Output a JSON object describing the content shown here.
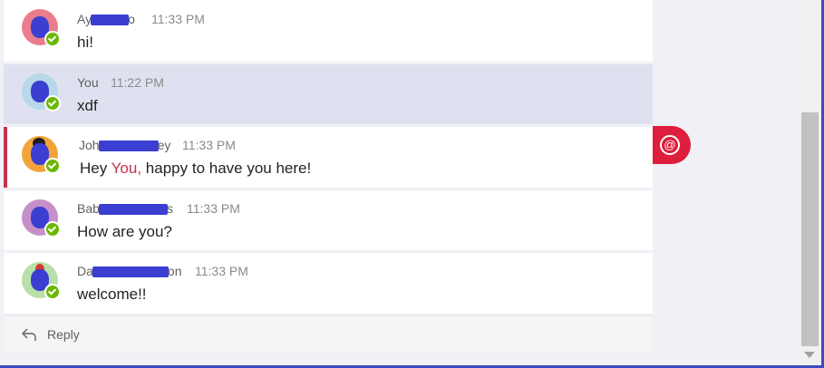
{
  "messages": [
    {
      "sender_visible_start": "Ay",
      "sender_visible_end": "o",
      "time": "11:33 PM",
      "text": "hi!",
      "avatar_bg": "#e97d8e"
    },
    {
      "sender": "You",
      "time": "11:22 PM",
      "text": "xdf",
      "avatar_bg": "#b7d8e8"
    },
    {
      "sender_visible_start": "Joh",
      "sender_visible_end": "ey",
      "time": "11:33 PM",
      "text_before": "Hey ",
      "mention": "You,",
      "text_after": " happy to have you here!",
      "avatar_bg": "#f2a43a"
    },
    {
      "sender_visible_start": "Bab",
      "sender_visible_end": "s",
      "time": "11:33 PM",
      "text": "How are you?",
      "avatar_bg": "#c68fc9"
    },
    {
      "sender_visible_start": "Da",
      "sender_visible_end": "on",
      "time": "11:33 PM",
      "text": "welcome!!",
      "avatar_bg": "#b8e0a8"
    }
  ],
  "reply": {
    "label": "Reply",
    "icon": "reply-arrow-icon"
  },
  "mention_flag": {
    "symbol": "@",
    "icon": "at-mention-icon"
  },
  "colors": {
    "accent": "#3b4bbf",
    "mention_red": "#c4314b",
    "mention_flag_bg": "#dd1f3d",
    "presence_available": "#6bb700",
    "highlight_row": "#e0e1f0"
  }
}
